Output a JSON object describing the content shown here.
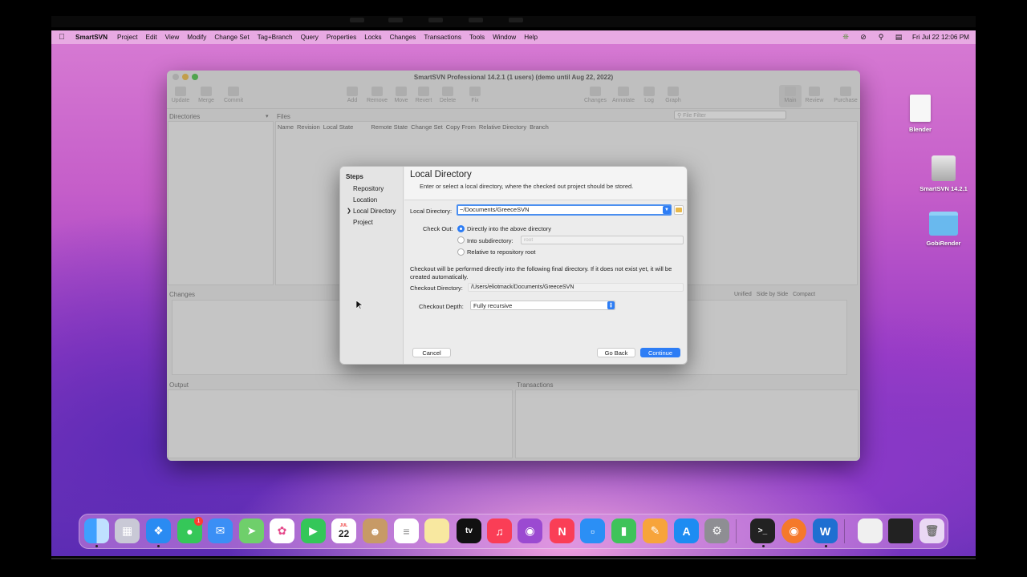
{
  "menubar": {
    "app": "SmartSVN",
    "items": [
      "Project",
      "Edit",
      "View",
      "Modify",
      "Change Set",
      "Tag+Branch",
      "Query",
      "Properties",
      "Locks",
      "Changes",
      "Transactions",
      "Tools",
      "Window",
      "Help"
    ],
    "clock": "Fri Jul 22  12:06 PM"
  },
  "window": {
    "title": "SmartSVN Professional 14.2.1 (1 users)  (demo until Aug 22, 2022)",
    "toolbar": [
      "Update",
      "Merge",
      "Commit",
      "Add",
      "Remove",
      "Move",
      "Revert",
      "Delete",
      "Fix",
      "Changes",
      "Annotate",
      "Log",
      "Graph",
      "Main",
      "Review",
      "Purchase"
    ],
    "panels": {
      "directories": "Directories",
      "files": "Files",
      "file_filter_placeholder": "File Filter",
      "columns": [
        "Name",
        "Revision",
        "Local State",
        "Remote State",
        "Change Set",
        "Copy From",
        "Relative Directory",
        "Branch"
      ],
      "changes": "Changes",
      "changes_controls": [
        "Unified",
        "Side by Side",
        "Compact"
      ],
      "output": "Output",
      "transactions": "Transactions"
    }
  },
  "dialog": {
    "steps_title": "Steps",
    "steps": [
      "Repository",
      "Location",
      "Local Directory",
      "Project"
    ],
    "current_step": "Local Directory",
    "title": "Local Directory",
    "subtitle": "Enter or select a local directory, where the checked out project should be stored.",
    "local_directory_label": "Local Directory:",
    "local_directory_value": "~/Documents/GreeceSVN",
    "checkout_label": "Check Out:",
    "options": [
      "Directly into the above directory",
      "Into subdirectory:",
      "Relative to repository root"
    ],
    "subdirectory_placeholder": "root",
    "note": "Checkout will be performed directly into the following final directory. If it does not exist yet, it will be created automatically.",
    "checkout_directory_label": "Checkout Directory:",
    "checkout_directory_value": "/Users/eliotmack/Documents/GreeceSVN",
    "depth_label": "Checkout Depth:",
    "depth_value": "Fully recursive",
    "cancel": "Cancel",
    "go_back": "Go Back",
    "continue": "Continue"
  },
  "desktop_icons": [
    "Blender",
    "SmartSVN 14.2.1",
    "GobiRender"
  ],
  "dock": {
    "calendar_month": "JUL",
    "calendar_day": "22",
    "messages_badge": "1",
    "apps": [
      "Finder",
      "Launchpad",
      "Safari",
      "Messages",
      "Mail",
      "Maps",
      "Photos",
      "FaceTime",
      "Calendar",
      "Contacts",
      "Reminders",
      "Notes",
      "TV",
      "Music",
      "Podcasts",
      "News",
      "Keynote",
      "Numbers",
      "Pages",
      "App Store",
      "System Preferences",
      "Terminal",
      "Blender",
      "SmartSVN",
      "Preview",
      "Screen",
      "Trash"
    ]
  }
}
